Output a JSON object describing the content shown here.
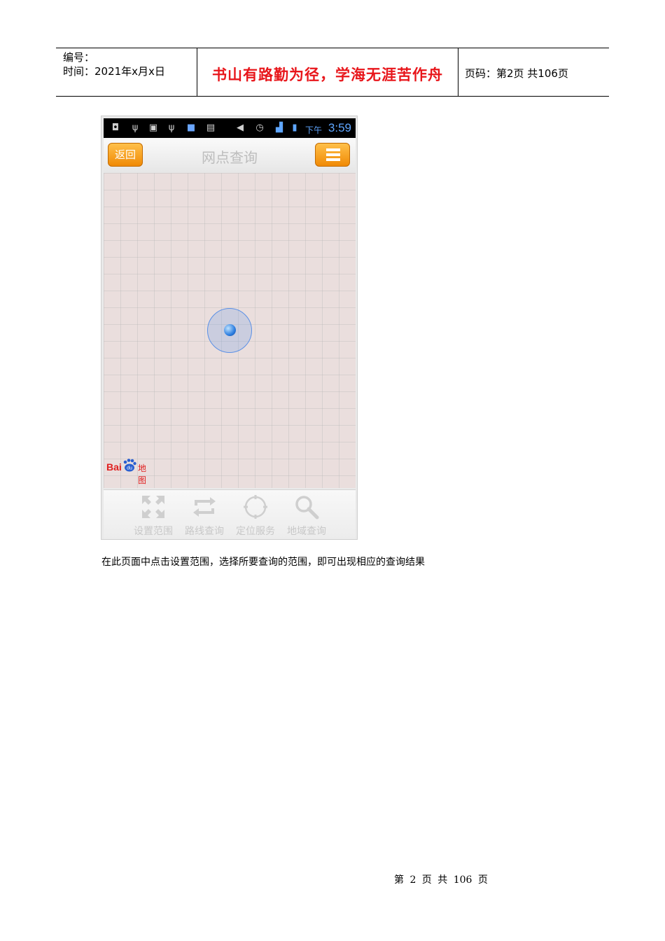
{
  "header": {
    "number_label": "编号：",
    "time_label": "时间：2021年x月x日",
    "motto": "书山有路勤为径，学海无涯苦作舟",
    "page_info": "页码：第2页 共106页"
  },
  "phone": {
    "status_bar": {
      "period": "下午",
      "time": "3:59"
    },
    "title_bar": {
      "back_label": "返回",
      "title": "网点查询",
      "menu_icon": "list-menu-icon"
    },
    "map": {
      "logo_text": "Bai",
      "logo_suffix": "地图",
      "location_icon": "current-location-icon"
    },
    "toolbar": {
      "items": [
        {
          "label": "设置范围",
          "icon": "expand-range-icon"
        },
        {
          "label": "路线查询",
          "icon": "route-icon"
        },
        {
          "label": "定位服务",
          "icon": "locate-icon"
        },
        {
          "label": "地域查询",
          "icon": "search-icon"
        }
      ]
    },
    "colors": {
      "accent": "#f59a16",
      "map_background": "#eadedd",
      "time_color": "#5fa6ff"
    }
  },
  "caption": "在此页面中点击设置范围，选择所要查询的范围，即可出现相应的查询结果",
  "footer": "第 2 页 共 106 页"
}
